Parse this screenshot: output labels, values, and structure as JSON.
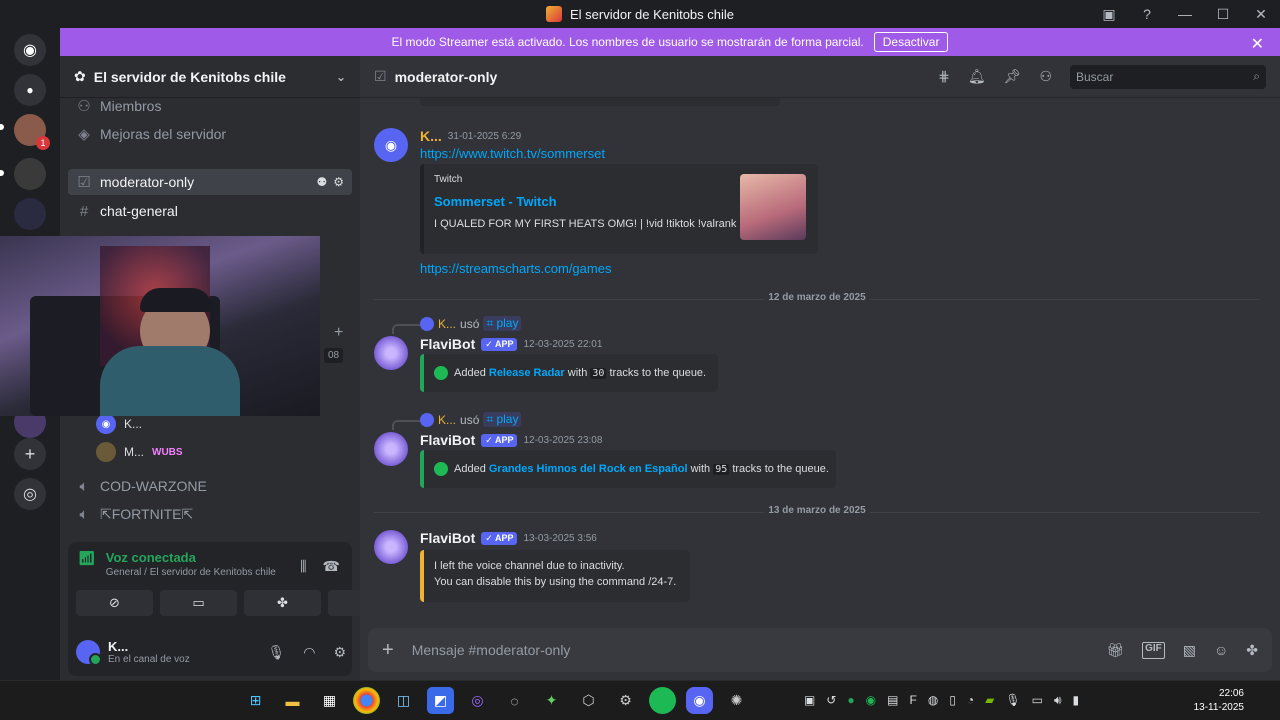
{
  "window": {
    "title": "El servidor de Kenitobs chile"
  },
  "banner": {
    "text": "El modo Streamer está activado. Los nombres de usuario se mostrarán de forma parcial.",
    "button": "Desactivar"
  },
  "server": {
    "name": "El servidor de Kenitobs chile",
    "badge": "1"
  },
  "channels": [
    {
      "name": "Miembros"
    },
    {
      "name": "Mejoras del servidor"
    },
    {
      "name": "moderator-only"
    },
    {
      "name": "chat-general"
    }
  ],
  "voice_users": [
    {
      "name": "K..."
    },
    {
      "name": "M...",
      "tag": "WUBS"
    }
  ],
  "voice_channels": [
    {
      "name": "COD-WARZONE"
    },
    {
      "name": "⇱FORTNITE⇱"
    }
  ],
  "side_count": "08",
  "voice_panel": {
    "status": "Voz conectada",
    "sub": "General / El servidor de Kenitobs chile"
  },
  "user": {
    "name": "K...",
    "status": "En el canal de voz"
  },
  "header": {
    "channel": "moderator-only",
    "search_placeholder": "Buscar"
  },
  "messages": {
    "m1": {
      "author": "K...",
      "time": "31-01-2025 6:29",
      "link": "https://www.twitch.tv/sommerset",
      "embed_provider": "Twitch",
      "embed_title": "Sommerset - Twitch",
      "embed_desc": "I QUALED FOR MY FIRST HEATS OMG! | !vid !tiktok !valrank",
      "link2": "https://streamscharts.com/games"
    },
    "d1": "12 de marzo de 2025",
    "m2": {
      "reply_user": "K...",
      "reply_verb": "usó",
      "reply_cmd": "play",
      "author": "FlaviBot",
      "badge": "APP",
      "time": "12-03-2025 22:01",
      "t1": "Added ",
      "playlist": "Release Radar",
      "t2": " with ",
      "count": "30",
      "t3": " tracks to the queue."
    },
    "m3": {
      "reply_user": "K...",
      "reply_verb": "usó",
      "reply_cmd": "play",
      "author": "FlaviBot",
      "badge": "APP",
      "time": "12-03-2025 23:08",
      "t1": "Added ",
      "playlist": "Grandes Himnos del Rock en Español",
      "t2": " with ",
      "count": "95",
      "t3": " tracks to the queue."
    },
    "d2": "13 de marzo de 2025",
    "m4": {
      "author": "FlaviBot",
      "badge": "APP",
      "time": "13-03-2025 3:56",
      "line1": "I left the voice channel due to inactivity.",
      "line2": "You can disable this by using the command /24-7."
    }
  },
  "composer": {
    "placeholder": "Mensaje #moderator-only"
  },
  "clock": {
    "time": "22:06",
    "date": "13-11-2025"
  },
  "colors": {
    "accent": "#5865f2",
    "streamer_banner": "#a05ae8",
    "spotify_green": "#23a55a",
    "warning": "#f0b232"
  }
}
